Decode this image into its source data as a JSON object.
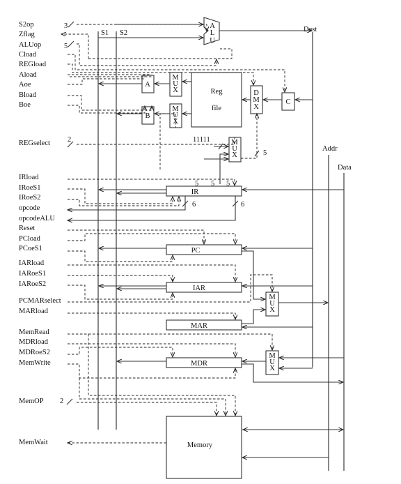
{
  "signals": {
    "s2op": "S2op",
    "zflag": "Zflag",
    "aluop": "ALUop",
    "cload": "Cload",
    "regload": "REGload",
    "aload": "Aload",
    "aoe": "Aoe",
    "bload": "Bload",
    "boe": "Boe",
    "regselect": "REGselect",
    "irload": "IRload",
    "iroes1": "IRoeS1",
    "iroes2": "IRoeS2",
    "opcode": "opcode",
    "opcodealu": "opcodeALU",
    "reset": "Reset",
    "pcload": "PCload",
    "pcoes1": "PCoeS1",
    "iarload": "IARload",
    "iaroes1": "IARoeS1",
    "iaroes2": "IARoeS2",
    "pcmarselect": "PCMARselect",
    "marload": "MARload",
    "memread": "MemRead",
    "mdrload": "MDRload",
    "mdroes2": "MDRoeS2",
    "memwrite": "MemWrite",
    "memop": "MemOP",
    "memwait": "MemWait"
  },
  "buses": {
    "s1": "S1",
    "s2": "S2",
    "dest": "Dest",
    "addr": "Addr",
    "data": "Data"
  },
  "components": {
    "alu": [
      "A",
      "L",
      "U"
    ],
    "a": "A",
    "b": "B",
    "c": "C",
    "mux": [
      "M",
      "U",
      "X"
    ],
    "dmx": [
      "D",
      "M",
      "X"
    ],
    "regfile": [
      "Reg",
      "file"
    ],
    "ir": "IR",
    "pc": "PC",
    "iar": "IAR",
    "mar": "MAR",
    "mdr": "MDR",
    "memory": "Memory",
    "const": "11111"
  },
  "widths": {
    "s2op": "3",
    "aluop": "5",
    "regselect": "2",
    "regsel_out": "5",
    "ir_a": "5",
    "ir_b": "5",
    "ir_c": "5",
    "opcode": "6",
    "opcodealu": "6",
    "memop": "2"
  }
}
